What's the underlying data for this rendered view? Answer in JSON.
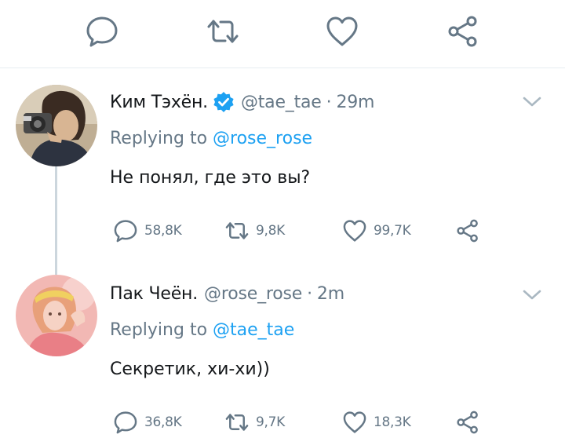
{
  "colors": {
    "accent": "#1da1f2",
    "icon_gray": "#657786",
    "text": "#14171a",
    "divider": "#e6ecf0",
    "thread_line": "#ccd6dd"
  },
  "top_actions": [
    {
      "icon": "reply-icon"
    },
    {
      "icon": "retweet-icon"
    },
    {
      "icon": "like-icon"
    },
    {
      "icon": "share-icon"
    }
  ],
  "tweets": [
    {
      "name": "Ким Тэхён.",
      "verified": true,
      "handle": "@tae_tae",
      "separator": "·",
      "time": "29m",
      "replying_prefix": "Replying to",
      "replying_to": "@rose_rose",
      "text": "Не понял, где это вы?",
      "replies": "58,8K",
      "retweets": "9,8K",
      "likes": "99,7K"
    },
    {
      "name": "Пак Чеён.",
      "verified": false,
      "handle": "@rose_rose",
      "separator": "·",
      "time": "2m",
      "replying_prefix": "Replying to",
      "replying_to": "@tae_tae",
      "text": "Секретик, хи-хи))",
      "replies": "36,8K",
      "retweets": "9,7K",
      "likes": "18,3K"
    }
  ]
}
